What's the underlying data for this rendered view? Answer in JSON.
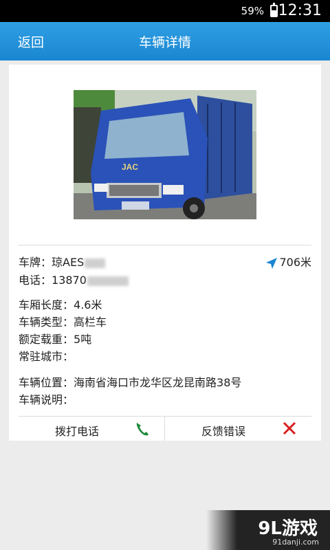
{
  "status_bar": {
    "battery_percent": "59%",
    "battery_level": 0.59,
    "time": "12:31"
  },
  "action_bar": {
    "back_label": "返回",
    "title": "车辆详情"
  },
  "vehicle": {
    "plate_label": "车牌：",
    "plate_value": "琼AES",
    "distance": "706米",
    "phone_label": "电话：",
    "phone_value": "13870",
    "box_length_label": "车厢长度：",
    "box_length_value": "4.6米",
    "type_label": "车辆类型：",
    "type_value": "高栏车",
    "load_label": "额定载重：",
    "load_value": "5吨",
    "city_label": "常驻城市：",
    "city_value": "",
    "location_label": "车辆位置：",
    "location_value": "海南省海口市龙华区龙昆南路38号",
    "desc_label": "车辆说明：",
    "desc_value": "",
    "truck_brand": "JAC"
  },
  "actions": {
    "call_label": "拨打电话",
    "report_label": "反馈错误"
  },
  "colors": {
    "accent": "#1a86d1",
    "call_icon": "#1f8a3a",
    "close_icon": "#d81e1e"
  },
  "watermark": {
    "logo": "9L游戏",
    "site": "91danji.com"
  }
}
